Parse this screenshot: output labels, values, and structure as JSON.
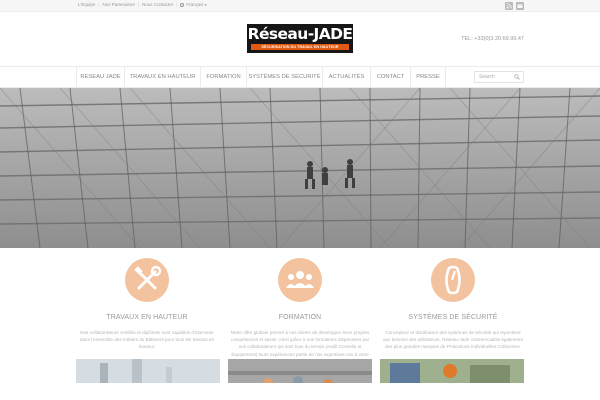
{
  "topbar": {
    "links": [
      "L'Equipe",
      "Nos Partenaires",
      "Nous Contacter"
    ],
    "language": "Français",
    "social_icons": [
      "rss-icon",
      "mail-icon"
    ]
  },
  "header": {
    "logo": {
      "name": "Réseau-JADE",
      "tagline": "SÉCURISATION DU TRAVAIL EN HAUTEUR"
    },
    "phone": "TEL: +33(0)3.20.69.99.47"
  },
  "nav": {
    "items": [
      "RESEAU JADE",
      "TRAVAUX EN HAUTEUR",
      "FORMATION",
      "SYSTÈMES DE SÉCURITÉ",
      "ACTUALITÉS",
      "CONTACT",
      "PRESSE"
    ],
    "search_placeholder": "Search"
  },
  "features": [
    {
      "icon": "tools-icon",
      "title": "TRAVAUX EN HAUTEUR",
      "text": "Nos collaborateurs certifiés et diplômés sont capables d'intervenir dans l'ensemble des métiers du Bâtiment pour tous les travaux en hauteur."
    },
    {
      "icon": "group-icon",
      "title": "FORMATION",
      "text": "Notre offre globale permet à nos clients de développer leurs propres compétences et savoir. Ainsi grâce à nos formations dispensées par nos collaborateurs qui sont tous du terrain (Audit Conseils et Équipement) leurs expériences partie de nos expertises rois à votre disposition."
    },
    {
      "icon": "carabiner-icon",
      "title": "SYSTÈMES DE SÉCURITÉ",
      "text": "Concepteur et distributeur des systèmes de sécurité qui répondent aux besoins des utilisateurs. Réseau-Jade commercialise également des plus grandes marques de Protections Individuelles Collectives."
    }
  ],
  "colors": {
    "accent": "#e05a14",
    "icon_circle": "#f3c3a0",
    "logo_bg": "#161616"
  }
}
